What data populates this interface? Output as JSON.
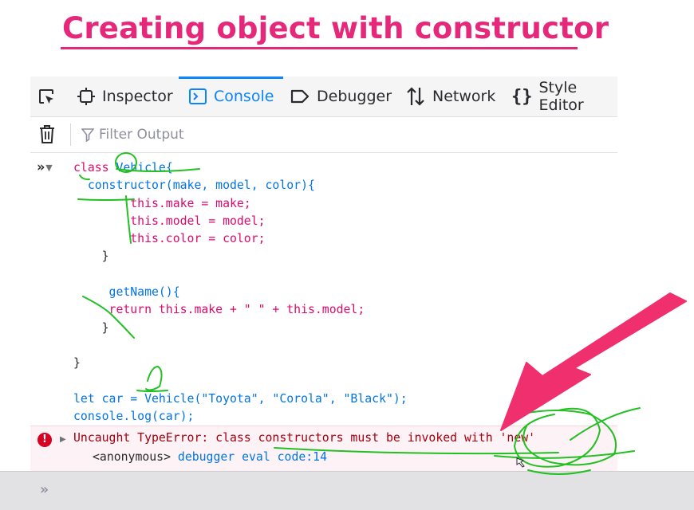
{
  "slide": {
    "title": "Creating object with constructor"
  },
  "toolbar": {
    "tabs": [
      {
        "label": "Inspector",
        "icon": "inspector-icon"
      },
      {
        "label": "Console",
        "icon": "console-icon",
        "active": true
      },
      {
        "label": "Debugger",
        "icon": "debugger-icon"
      },
      {
        "label": "Network",
        "icon": "network-icon"
      },
      {
        "label": "Style Editor",
        "icon": "style-editor-icon"
      }
    ],
    "picker_icon": "element-picker-icon"
  },
  "filter": {
    "placeholder": "Filter Output",
    "clear_icon": "trash-icon"
  },
  "console": {
    "prompt": "»",
    "code_lines": [
      {
        "kw": "class ",
        "rest_id": "Vehicle",
        "tail": "{"
      },
      {
        "text": "  constructor(make, model, color){"
      },
      {
        "text": "        this.make = make;"
      },
      {
        "text": "        this.model = model;"
      },
      {
        "text": "        this.color = color;"
      },
      {
        "text": "    }"
      },
      {
        "text": ""
      },
      {
        "text": "     getName(){"
      },
      {
        "text": "     return this.make + \" \" + this.model;"
      },
      {
        "text": "    }"
      },
      {
        "text": ""
      },
      {
        "text": "}"
      },
      {
        "text": ""
      },
      {
        "text": "let car = Vehicle(\"Toyota\", \"Corola\", \"Black\");"
      },
      {
        "text": "console.log(car);"
      }
    ],
    "error": {
      "message": "Uncaught TypeError: class constructors must be invoked with 'new'",
      "stack_fn": "<anonymous>",
      "stack_loc": "debugger eval code:14"
    },
    "input_prompt": "»"
  },
  "colors": {
    "title": "#e5287a",
    "accent": "#0a84ff",
    "keyword": "#dd0a6b",
    "identifier": "#0074e8",
    "error": "#a4000f",
    "annotation_green": "#22c022",
    "annotation_arrow": "#f0306e"
  }
}
